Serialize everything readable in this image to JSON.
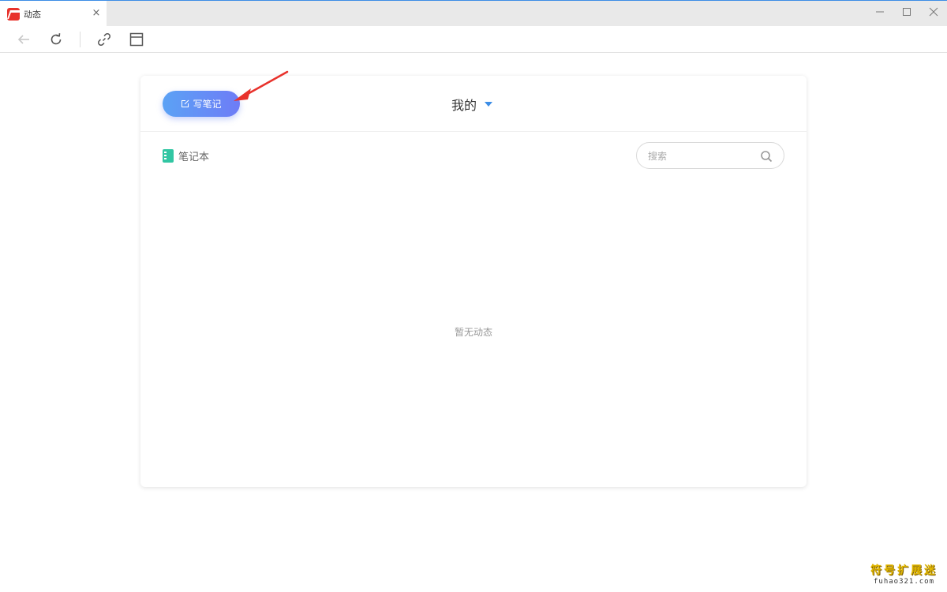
{
  "tab": {
    "title": "动态",
    "close": "×"
  },
  "window_controls": {
    "minimize": "—",
    "maximize": "☐",
    "close": "✕"
  },
  "card": {
    "write_button": "写笔记",
    "view_selector": "我的",
    "notebook": "笔记本",
    "search": {
      "placeholder": "搜索"
    },
    "empty_message": "暂无动态"
  },
  "annotation_color": "#e8322c",
  "watermark": {
    "main": "符号扩展迷",
    "sub": "fuhao321.com"
  }
}
